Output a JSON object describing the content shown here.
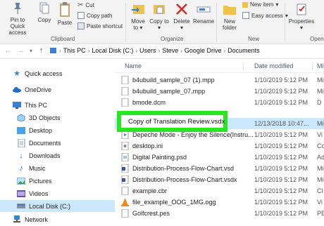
{
  "ribbon": {
    "pin_label": "Pin to Quick access",
    "copy_label": "Copy",
    "paste_label": "Paste",
    "cut_label": "Cut",
    "copy_path_label": "Copy path",
    "paste_shortcut_label": "Paste shortcut",
    "clipboard_group": "Clipboard",
    "move_to_label": "Move to",
    "copy_to_label": "Copy to",
    "delete_label": "Delete",
    "rename_label": "Rename",
    "organize_group": "Organize",
    "new_folder_label": "New folder",
    "new_item_label": "New item",
    "easy_access_label": "Easy access",
    "new_group": "New",
    "properties_label": "Properties",
    "open_group": "Open"
  },
  "address": {
    "crumbs": [
      "This PC",
      "Local Disk (C:)",
      "Users",
      "Steve",
      "Google Drive",
      "Documents"
    ]
  },
  "sidebar": {
    "items": [
      {
        "label": "Quick access",
        "icon": "star-icon"
      },
      {
        "label": "OneDrive",
        "icon": "cloud-icon"
      },
      {
        "label": "This PC",
        "icon": "computer-icon"
      },
      {
        "label": "3D Objects",
        "icon": "cube-icon"
      },
      {
        "label": "Desktop",
        "icon": "desktop-folder-icon"
      },
      {
        "label": "Documents",
        "icon": "documents-icon"
      },
      {
        "label": "Downloads",
        "icon": "download-icon"
      },
      {
        "label": "Music",
        "icon": "music-icon"
      },
      {
        "label": "Pictures",
        "icon": "pictures-icon"
      },
      {
        "label": "Videos",
        "icon": "videos-icon"
      },
      {
        "label": "Local Disk (C:)",
        "icon": "disk-icon"
      },
      {
        "label": "Network",
        "icon": "network-icon"
      }
    ]
  },
  "files": {
    "columns": {
      "name": "Name",
      "date": "Date modified",
      "type": "Mi"
    },
    "rows": [
      {
        "name": "b4ubuild_sample_07 (1).mpp",
        "date": "1/10/2019 5:12 PM",
        "type": "Mi"
      },
      {
        "name": "b4ubuild_sample_07.mpp",
        "date": "1/10/2019 5:12 PM",
        "type": "Mi"
      },
      {
        "name": "bmode.dcm",
        "date": "1/10/2019 5:12 PM",
        "type": "D"
      },
      {
        "name": "Copy of Translation Review.vsdx",
        "date": "12/13/2018 10:47...",
        "type": "Mi"
      },
      {
        "name": "Depeche Mode - Enjoy the Silence(Instru...",
        "date": "1/10/2019 5:12 PM",
        "type": "Vi"
      },
      {
        "name": "desktop.ini",
        "date": "1/10/2019 5:12 PM",
        "type": "Co"
      },
      {
        "name": "Digital Painting.psd",
        "date": "1/10/2019 5:12 PM",
        "type": "Ad"
      },
      {
        "name": "Distribution-Process-Flow-Chart.vsd",
        "date": "1/10/2019 5:12 PM",
        "type": "Mi"
      },
      {
        "name": "Distribution-Process-Flow-Chart.vsdx",
        "date": "1/10/2019 5:12 PM",
        "type": "Mi"
      },
      {
        "name": "example.cbr",
        "date": "1/10/2019 5:12 PM",
        "type": "CI"
      },
      {
        "name": "file_example_OOG_1MG.ogg",
        "date": "1/10/2019 5:12 PM",
        "type": "Vi"
      },
      {
        "name": "Golfcrest.pes",
        "date": "1/10/2019 5:12 PM",
        "type": "PE"
      }
    ]
  },
  "highlight": {
    "name": "Copy of Translation Review.vsdx"
  },
  "colors": {
    "highlight_border": "#27e81f",
    "selection": "#cce8ff",
    "delete_red": "#d32f2f",
    "folder_yellow": "#f0c24a"
  }
}
